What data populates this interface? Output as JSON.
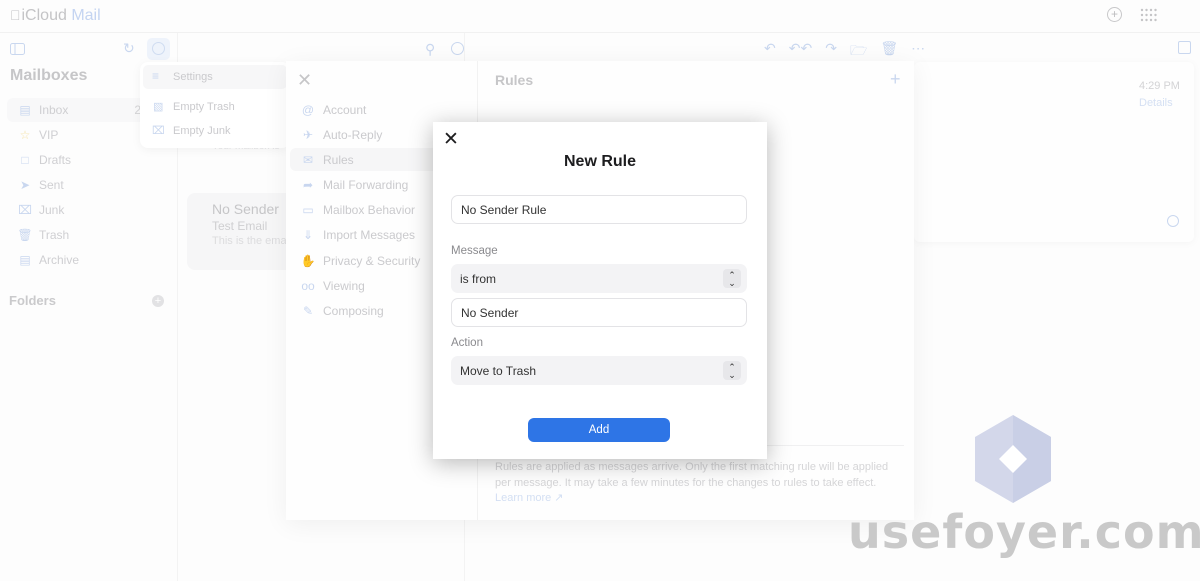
{
  "topbar": {
    "brand_prefix": "iCloud",
    "brand_suffix": "Mail",
    "icons": [
      "plus-circle-icon",
      "app-grid-icon"
    ]
  },
  "sidebar": {
    "title": "Mailboxes",
    "items": [
      {
        "label": "Inbox",
        "icon": "inbox-icon",
        "count": "2",
        "active": true
      },
      {
        "label": "VIP",
        "icon": "star-icon"
      },
      {
        "label": "Drafts",
        "icon": "document-icon"
      },
      {
        "label": "Sent",
        "icon": "paper-plane-icon"
      },
      {
        "label": "Junk",
        "icon": "junk-icon"
      },
      {
        "label": "Trash",
        "icon": "trash-icon"
      },
      {
        "label": "Archive",
        "icon": "archive-icon"
      }
    ],
    "folders_label": "Folders"
  },
  "popover": {
    "items": [
      {
        "label": "Settings",
        "icon": "list-icon"
      },
      {
        "label": "Empty Trash",
        "icon": "trash-icon"
      },
      {
        "label": "Empty Junk",
        "icon": "junk-icon"
      }
    ]
  },
  "message_list": {
    "hidden_note": "Your mailbox is",
    "message": {
      "sender": "No Sender",
      "subject": "Test Email",
      "preview": "This is the email"
    }
  },
  "settings": {
    "nav": [
      {
        "label": "Account",
        "icon": "at-icon"
      },
      {
        "label": "Auto-Reply",
        "icon": "plane-icon"
      },
      {
        "label": "Rules",
        "icon": "rules-icon",
        "active": true
      },
      {
        "label": "Mail Forwarding",
        "icon": "forward-icon"
      },
      {
        "label": "Mailbox Behavior",
        "icon": "folder-icon"
      },
      {
        "label": "Import Messages",
        "icon": "import-icon"
      },
      {
        "label": "Privacy & Security",
        "icon": "hand-icon"
      },
      {
        "label": "Viewing",
        "icon": "glasses-icon"
      },
      {
        "label": "Composing",
        "icon": "compose-icon"
      }
    ],
    "rules_title": "Rules",
    "footer_text": "Rules are applied as messages arrive. Only the first matching rule will be applied per message. It may take a few minutes for the changes to rules to take effect.",
    "learn_more": "Learn more ↗"
  },
  "reader": {
    "time": "4:29 PM",
    "details": "Details"
  },
  "modal": {
    "title": "New Rule",
    "rule_name_value": "No Sender Rule",
    "message_label": "Message",
    "condition_value": "is from",
    "condition_target_value": "No Sender",
    "action_label": "Action",
    "action_value": "Move to Trash",
    "add_label": "Add"
  },
  "watermark": {
    "text": "usefoyer.com"
  },
  "colors": {
    "accent": "#2e75e6",
    "watermark_logo": "#d3d7ea"
  }
}
